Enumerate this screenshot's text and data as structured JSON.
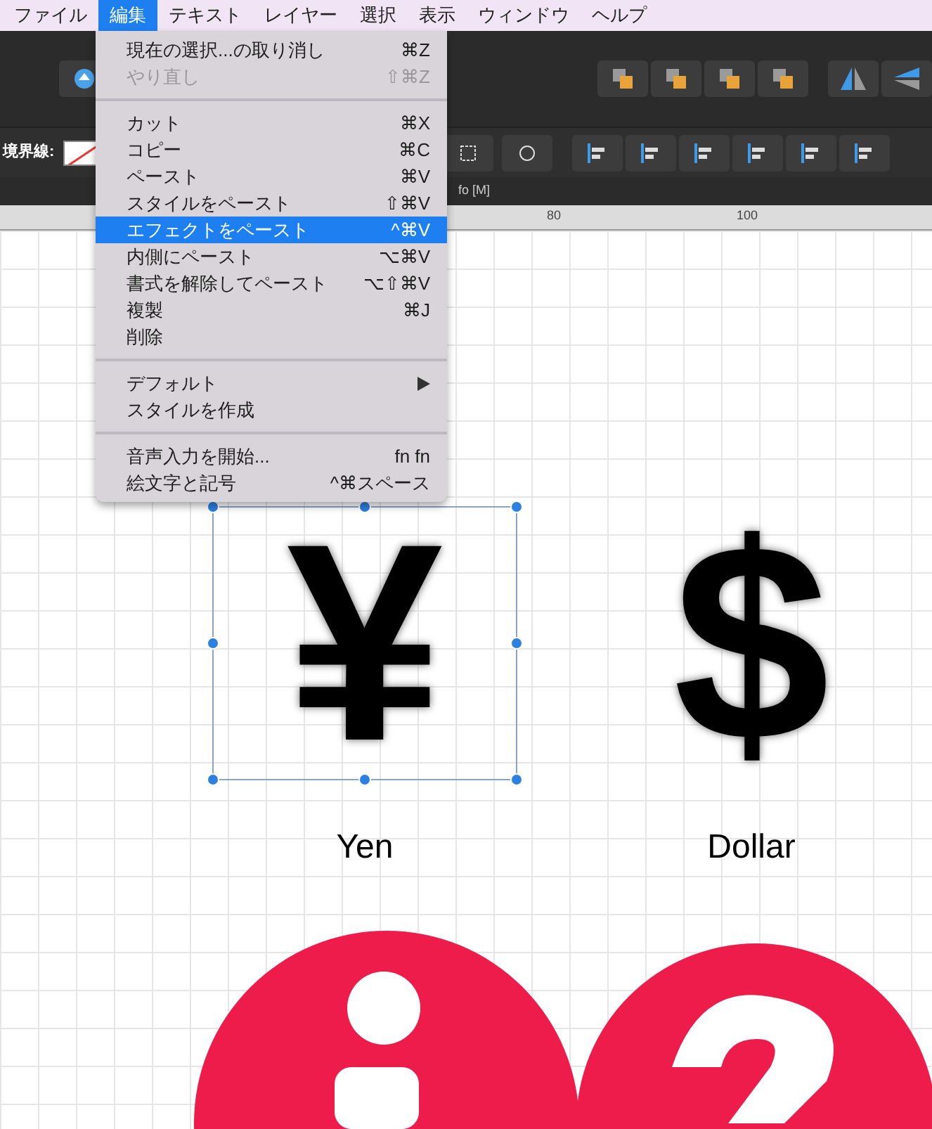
{
  "menubar": [
    {
      "label": "ファイル",
      "selected": false
    },
    {
      "label": "編集",
      "selected": true
    },
    {
      "label": "テキスト",
      "selected": false
    },
    {
      "label": "レイヤー",
      "selected": false
    },
    {
      "label": "選択",
      "selected": false
    },
    {
      "label": "表示",
      "selected": false
    },
    {
      "label": "ウィンドウ",
      "selected": false
    },
    {
      "label": "ヘルプ",
      "selected": false
    }
  ],
  "edit_menu": [
    {
      "kind": "item",
      "label": "現在の選択...の取り消し",
      "shortcut": "⌘Z",
      "disabled": false,
      "selected": false
    },
    {
      "kind": "item",
      "label": "やり直し",
      "shortcut": "⇧⌘Z",
      "disabled": true,
      "selected": false
    },
    {
      "kind": "separator"
    },
    {
      "kind": "item",
      "label": "カット",
      "shortcut": "⌘X",
      "disabled": false,
      "selected": false
    },
    {
      "kind": "item",
      "label": "コピー",
      "shortcut": "⌘C",
      "disabled": false,
      "selected": false
    },
    {
      "kind": "item",
      "label": "ペースト",
      "shortcut": "⌘V",
      "disabled": false,
      "selected": false
    },
    {
      "kind": "item",
      "label": "スタイルをペースト",
      "shortcut": "⇧⌘V",
      "disabled": false,
      "selected": false
    },
    {
      "kind": "item",
      "label": "エフェクトをペースト",
      "shortcut": "^⌘V",
      "disabled": false,
      "selected": true
    },
    {
      "kind": "item",
      "label": "内側にペースト",
      "shortcut": "⌥⌘V",
      "disabled": false,
      "selected": false
    },
    {
      "kind": "item",
      "label": "書式を解除してペースト",
      "shortcut": "⌥⇧⌘V",
      "disabled": false,
      "selected": false
    },
    {
      "kind": "item",
      "label": "複製",
      "shortcut": "⌘J",
      "disabled": false,
      "selected": false
    },
    {
      "kind": "item",
      "label": "削除",
      "disabled": false,
      "selected": false
    },
    {
      "kind": "separator"
    },
    {
      "kind": "submenu",
      "label": "デフォルト",
      "disabled": false,
      "selected": false
    },
    {
      "kind": "item",
      "label": "スタイルを作成",
      "disabled": false,
      "selected": false
    },
    {
      "kind": "separator"
    },
    {
      "kind": "item",
      "label": "音声入力を開始...",
      "shortcut": "fn fn",
      "disabled": false,
      "selected": false
    },
    {
      "kind": "item",
      "label": "絵文字と記号",
      "shortcut": "^⌘スペース",
      "disabled": false,
      "selected": false
    }
  ],
  "context_toolbar": {
    "stroke_label": "境界線:"
  },
  "info_line": "fo [M]",
  "ruler": {
    "labels": [
      "80",
      "100"
    ]
  },
  "canvas": {
    "symbols": [
      {
        "glyph": "¥",
        "caption": "Yen",
        "selected": true
      },
      {
        "glyph": "$",
        "caption": "Dollar",
        "selected": false
      }
    ]
  }
}
